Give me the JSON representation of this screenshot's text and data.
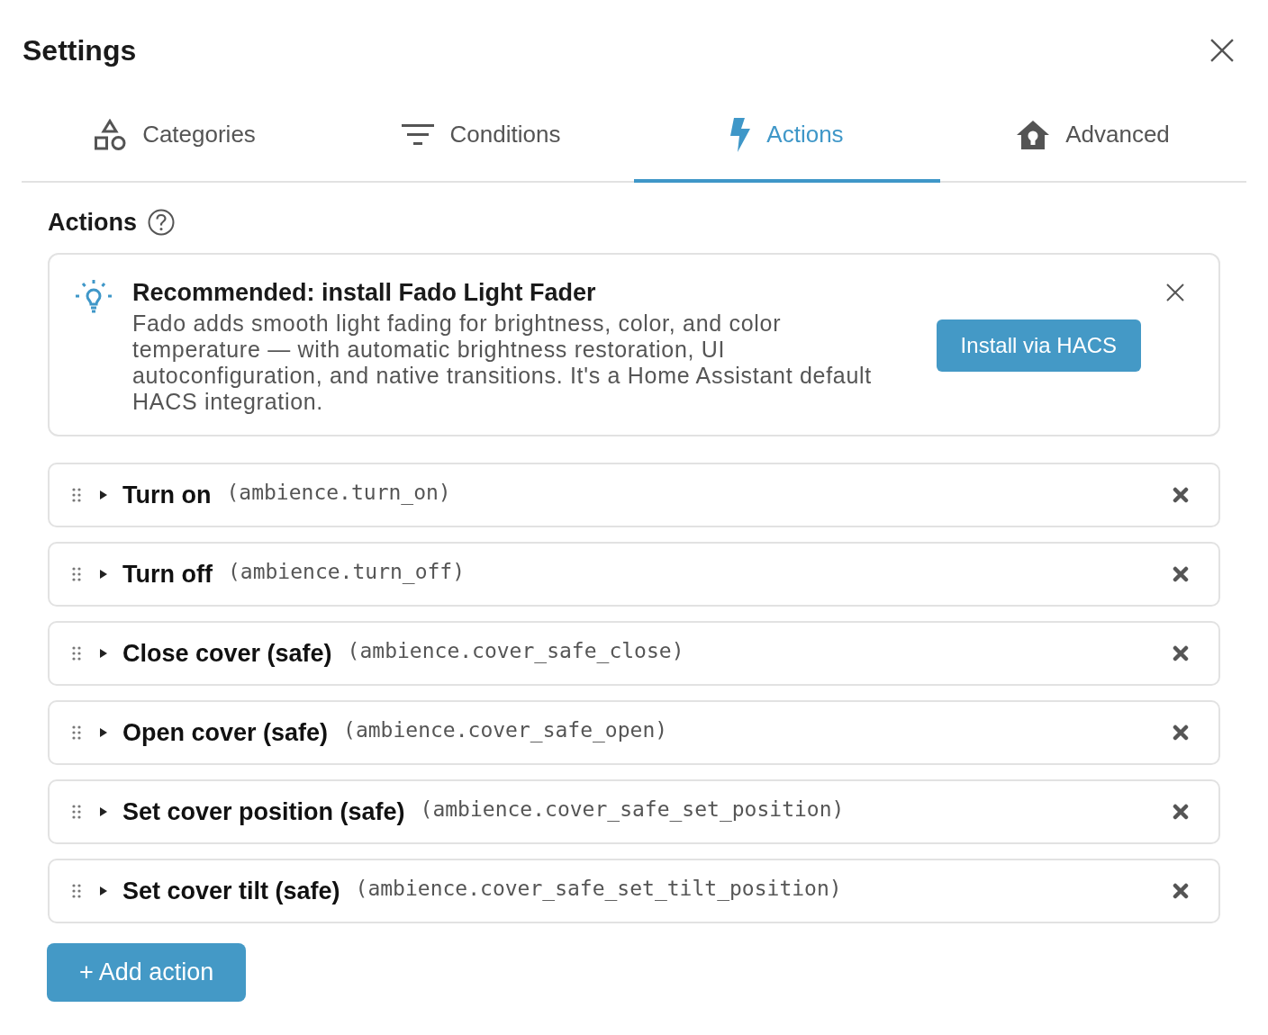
{
  "dialog": {
    "title": "Settings"
  },
  "tabs": [
    {
      "label": "Categories",
      "selected": false
    },
    {
      "label": "Conditions",
      "selected": false
    },
    {
      "label": "Actions",
      "selected": true
    },
    {
      "label": "Advanced",
      "selected": false
    }
  ],
  "section": {
    "heading": "Actions"
  },
  "recommendation": {
    "title": "Recommended: install Fado Light Fader",
    "description": "Fado adds smooth light fading for brightness, color, and color temperature — with automatic brightness restoration, UI autoconfiguration, and native transitions. It's a Home Assistant default HACS integration.",
    "button": "Install via HACS"
  },
  "actions": [
    {
      "name": "Turn on",
      "service": "(ambience.turn_on)",
      "expanded": false
    },
    {
      "name": "Turn off",
      "service": "(ambience.turn_off)",
      "expanded": false
    },
    {
      "name": "Close cover (safe)",
      "service": "(ambience.cover_safe_close)",
      "expanded": false
    },
    {
      "name": "Open cover (safe)",
      "service": "(ambience.cover_safe_open)",
      "expanded": false
    },
    {
      "name": "Set cover position (safe)",
      "service": "(ambience.cover_safe_set_position)",
      "expanded": false
    },
    {
      "name": "Set cover tilt (safe)",
      "service": "(ambience.cover_safe_set_tilt_position)",
      "expanded": false
    }
  ],
  "add_button": "+ Add action"
}
